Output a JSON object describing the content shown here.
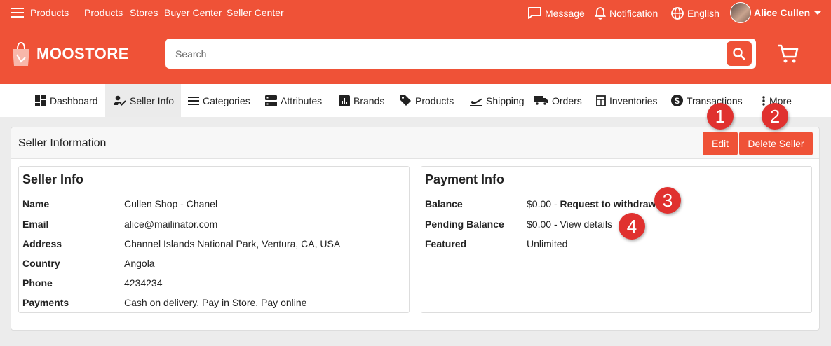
{
  "topnav": {
    "links": [
      "Products",
      "Products",
      "Stores",
      "Buyer Center",
      "Seller Center"
    ],
    "message": "Message",
    "notification": "Notification",
    "language": "English",
    "user": "Alice Cullen"
  },
  "brand": {
    "name": "MOOSTORE"
  },
  "search": {
    "placeholder": "Search"
  },
  "nav": {
    "items": [
      "Dashboard",
      "Seller Info",
      "Categories",
      "Attributes",
      "Brands",
      "Products",
      "Shipping",
      "Orders",
      "Inventories",
      "Transactions",
      "More"
    ],
    "active": "Seller Info"
  },
  "card": {
    "title": "Seller Information",
    "edit": "Edit",
    "delete": "Delete Seller"
  },
  "seller_info": {
    "title": "Seller Info",
    "rows": [
      {
        "label": "Name",
        "value": "Cullen Shop - Chanel"
      },
      {
        "label": "Email",
        "value": "alice@mailinator.com"
      },
      {
        "label": "Address",
        "value": "Channel Islands National Park, Ventura, CA, USA"
      },
      {
        "label": "Country",
        "value": "Angola"
      },
      {
        "label": "Phone",
        "value": "4234234"
      },
      {
        "label": "Payments",
        "value": "Cash on delivery, Pay in Store, Pay online"
      }
    ]
  },
  "payment_info": {
    "title": "Payment Info",
    "balance_label": "Balance",
    "balance_value": "$0.00",
    "balance_sep": "-",
    "withdraw": "Request to withdraw",
    "pending_label": "Pending Balance",
    "pending_value": "$0.00",
    "pending_sep": "-",
    "view_details": "View details",
    "featured_label": "Featured",
    "featured_value": "Unlimited"
  },
  "markers": [
    "1",
    "2",
    "3",
    "4"
  ],
  "colors": {
    "brand": "#ef5237",
    "marker": "#e0312f",
    "nav_active": "#ebebeb"
  }
}
